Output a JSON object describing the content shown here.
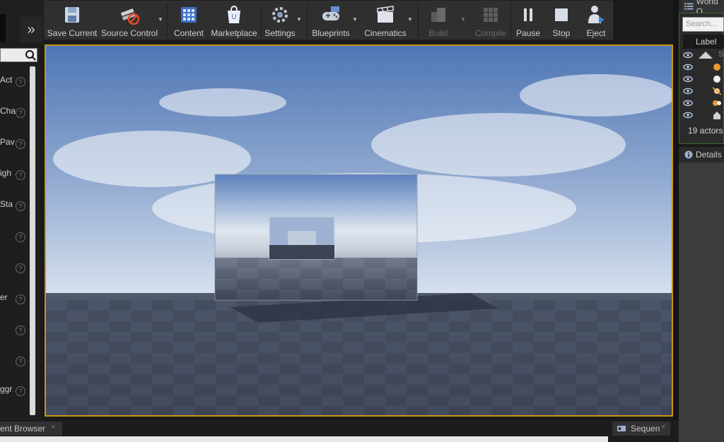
{
  "toolbar": {
    "items": [
      {
        "label": "Save Current",
        "icon": "save-icon"
      },
      {
        "label": "Source Control",
        "icon": "source-control-icon"
      },
      {
        "label": "Content",
        "icon": "content-icon"
      },
      {
        "label": "Marketplace",
        "icon": "marketplace-icon"
      },
      {
        "label": "Settings",
        "icon": "settings-icon"
      },
      {
        "label": "Blueprints",
        "icon": "blueprints-icon"
      },
      {
        "label": "Cinematics",
        "icon": "cinematics-icon"
      },
      {
        "label": "Build",
        "icon": "build-icon",
        "disabled": true
      },
      {
        "label": "Compile",
        "icon": "compile-icon",
        "disabled": true
      },
      {
        "label": "Pause",
        "icon": "pause-icon"
      },
      {
        "label": "Stop",
        "icon": "stop-icon"
      },
      {
        "label": "Eject",
        "icon": "eject-icon"
      }
    ]
  },
  "left_panel": {
    "expand_glyph": "»",
    "rows": [
      "Act",
      "Cha",
      "Pav",
      "igh",
      "Sta",
      "",
      "",
      "er",
      "",
      "",
      "ggr"
    ]
  },
  "world_outliner": {
    "tab_label": "World O",
    "search_placeholder": "Search...",
    "column_header": "Label",
    "first_row_text": "S",
    "actor_count": "19 actors"
  },
  "details": {
    "tab_label": "Details"
  },
  "bottom_tabs": {
    "content_browser": "ent Browser",
    "sequencer": "Sequen",
    "close_glyph": "×"
  },
  "colors": {
    "viewport_border": "#c99412",
    "toolbar_bg": "#2f2f2f",
    "panel_bg": "#1e1e1e"
  }
}
